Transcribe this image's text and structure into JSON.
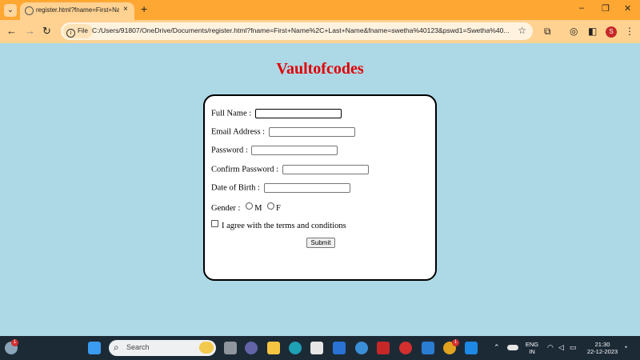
{
  "browser": {
    "tab_title": "register.html?fname=First+Name%2C",
    "tab_close": "×",
    "new_tab": "+",
    "file_chip": "File",
    "url": "C:/Users/91807/OneDrive/Documents/register.html?fname=First+Name%2C+Last+Name&fname=swetha%40123&pswd1=Swetha%40...",
    "profile_initial": "S",
    "window_controls": [
      "–",
      "❐",
      "✕"
    ]
  },
  "page": {
    "title": "Vaultofcodes",
    "form": {
      "full_name_label": "Full Name :",
      "email_label": "Email Address :",
      "password_label": "Password :",
      "confirm_password_label": "Confirm Password :",
      "dob_label": "Date of Birth :",
      "gender_label": "Gender :",
      "gender_options": [
        "M",
        "F"
      ],
      "terms_label": "I agree with the terms and conditions",
      "submit_label": "Submit"
    }
  },
  "taskbar": {
    "search_placeholder": "Search",
    "language_top": "ENG",
    "language_bottom": "IN",
    "time": "21:30",
    "date": "22-12-2023",
    "weather_badge": "1",
    "chrome_badge": "1"
  },
  "colors": {
    "page_background": "#add8e6",
    "title_color": "#e00000",
    "tab_bar": "#ffa733",
    "toolbar": "#ffd291",
    "taskbar": "#1c2a36"
  }
}
